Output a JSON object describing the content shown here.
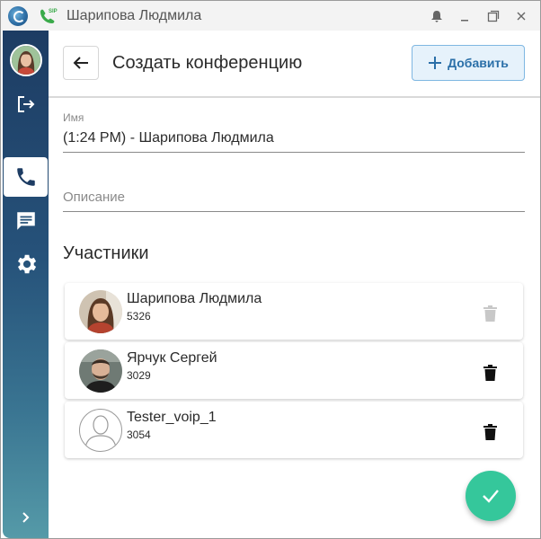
{
  "window": {
    "title": "Шарипова Людмила",
    "sip_badge": "SIP"
  },
  "sidebar": {
    "items": [
      {
        "name": "logout",
        "icon": "logout-icon"
      },
      {
        "name": "calls",
        "icon": "phone-icon",
        "active": true
      },
      {
        "name": "chat",
        "icon": "chat-icon"
      },
      {
        "name": "settings",
        "icon": "gear-icon"
      }
    ],
    "expand_icon": "chevron-right-icon"
  },
  "header": {
    "title": "Создать конференцию",
    "add_label": "Добавить"
  },
  "form": {
    "name_label": "Имя",
    "name_value": "(1:24 PM) - Шарипова Людмила",
    "description_placeholder": "Описание"
  },
  "participants": {
    "title": "Участники",
    "items": [
      {
        "name": "Шарипова Людмила",
        "ext": "5326",
        "delete_enabled": false
      },
      {
        "name": "Ярчук Сергей",
        "ext": "3029",
        "delete_enabled": true
      },
      {
        "name": "Tester_voip_1",
        "ext": "3054",
        "delete_enabled": true
      }
    ]
  },
  "colors": {
    "accent": "#35c79b",
    "sidebar_top": "#1d3c63",
    "sidebar_bottom": "#559aa8",
    "add_button_text": "#2a6fa8"
  }
}
